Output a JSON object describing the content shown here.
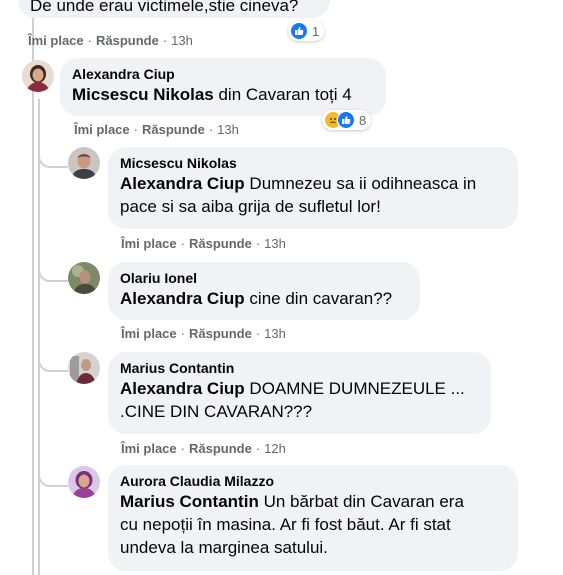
{
  "top_comment": {
    "text": "De unde erau victimele,stie cineva?",
    "like_label": "Îmi place",
    "reply_label": "Răspunde",
    "time": "13h",
    "reactions": {
      "count": "1",
      "icons": [
        "like-icon"
      ]
    }
  },
  "comments": [
    {
      "author": "Alexandra Ciup",
      "tag": "Micsescu Nikolas",
      "text": " din Cavaran toți 4",
      "like_label": "Îmi place",
      "reply_label": "Răspunde",
      "time": "13h",
      "reactions": {
        "count": "8",
        "icons": [
          "sad-icon",
          "like-icon"
        ]
      }
    },
    {
      "author": "Micsescu Nikolas",
      "tag": "Alexandra Ciup",
      "text": " Dumnezeu sa ii odihneasca in\npace si sa aiba grija de sufletul lor!",
      "like_label": "Îmi place",
      "reply_label": "Răspunde",
      "time": "13h"
    },
    {
      "author": "Olariu Ionel",
      "tag": "Alexandra Ciup",
      "text": " cine din cavaran??",
      "like_label": "Îmi place",
      "reply_label": "Răspunde",
      "time": "13h"
    },
    {
      "author": "Marius Contantin",
      "tag": "Alexandra Ciup",
      "text": " DOAMNE DUMNEZEULE ...\n.CINE DIN CAVARAN???",
      "like_label": "Îmi place",
      "reply_label": "Răspunde",
      "time": "12h"
    },
    {
      "author": "Aurora Claudia Milazzo",
      "tag": "Marius Contantin",
      "text": " Un bărbat din Cavaran era\ncu nepoții în masina. Ar fi fost băut. Ar fi stat\nundeva la marginea satului.",
      "like_label": "",
      "reply_label": "",
      "time": ""
    }
  ],
  "colors": {
    "bubble": "#f0f2f5",
    "meta": "#65676b",
    "like_blue": "#1877f2",
    "sad_yellow": "#f7b928",
    "thread_line": "#ced0d4"
  }
}
